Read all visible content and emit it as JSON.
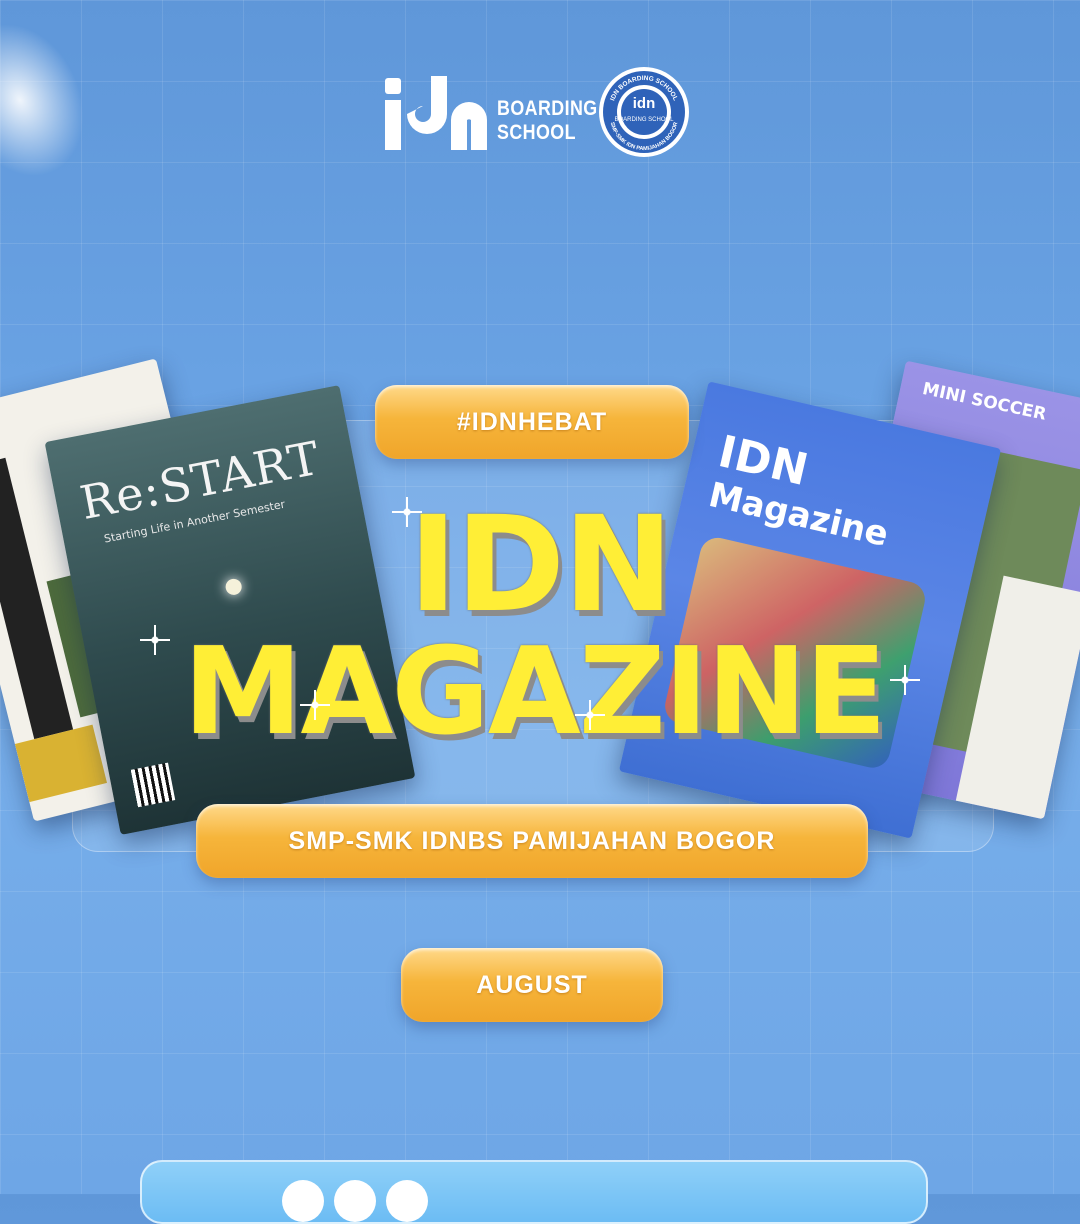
{
  "header": {
    "logo_line1": "BOARDING",
    "logo_line2": "SCHOOL",
    "seal_top": "IDN BOARDING SCHOOL",
    "seal_bottom": "SMP-SMK IDN PAMIJAHAN BOGOR",
    "seal_inner": "BOARDING SCHOOL"
  },
  "hashtag": "#IDNHEBAT",
  "headline": {
    "line1": "IDN",
    "line2": "MAGAZINE"
  },
  "school": "SMP-SMK IDNBS PAMIJAHAN BOGOR",
  "month": "AUGUST",
  "magazines": {
    "restart_title": "Re:START",
    "restart_sub": "Starting Life in Another Semester",
    "idn_line1": "IDN",
    "idn_line2": "Magazine",
    "soccer_header": "MINI SOCCER"
  },
  "colors": {
    "background": "#6aa3e4",
    "headline": "#ffee36",
    "pill": "#f6b53b"
  },
  "icons": [
    "idn-logo-icon",
    "school-seal-icon",
    "sparkle-icon",
    "social-icon"
  ]
}
